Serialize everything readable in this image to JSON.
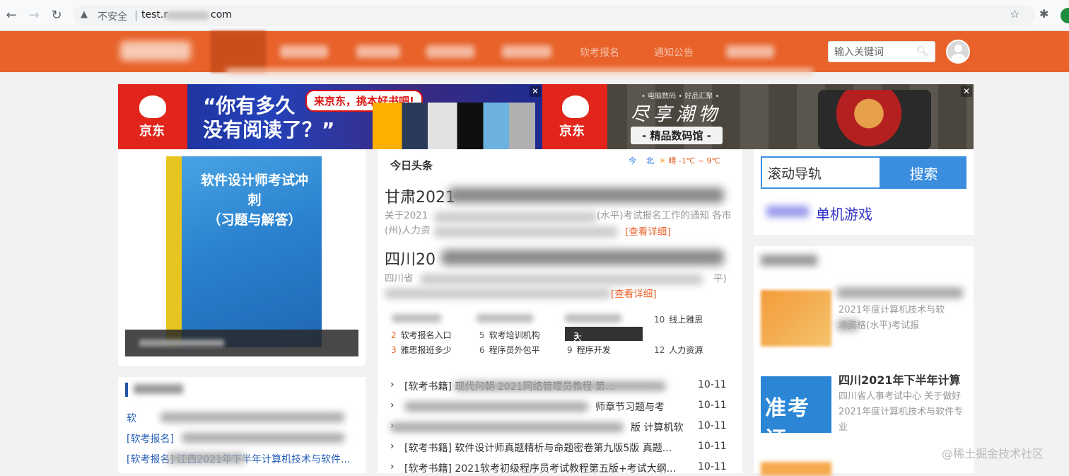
{
  "browser": {
    "insecure_label": "不安全",
    "url_prefix": "test.r",
    "url_suffix": "com"
  },
  "header": {
    "nav": [
      "软考报名",
      "通知公告"
    ],
    "search_placeholder": "输入关键词"
  },
  "ads": {
    "left_brand": "京东",
    "left_quote": "“你有多久\n没有阅读了？”",
    "left_bubble": "来京东，挑本好书吧!",
    "right_brand": "京东",
    "right_small": "• 电脑数码 • 好品汇聚 •",
    "right_slogan": "尽享潮物",
    "right_pill": "- 精品数码馆 -",
    "close": "✕"
  },
  "book": {
    "title": "软件设计师考试冲刺\n（习题与解答）"
  },
  "left_news": {
    "items": [
      "软",
      "[软考报名]",
      "[软考报名]  江西2021年下半年计算机技术与软件..."
    ]
  },
  "today": {
    "title": "今日头条",
    "weather_today": "今",
    "weather_city": "北",
    "weather_temp": "晴 -1℃ ~ 9℃",
    "headline1": "甘肃2021",
    "summary1_a": "关于2021",
    "summary1_b": "(水平)考试报名工作的通知 各市",
    "summary1_c": "(州)人力资",
    "more1": "[查看详细]",
    "headline2": "四川20",
    "summary2_a": "四川省",
    "summary2_b": "平)",
    "more2": "[查看详细]"
  },
  "rank": {
    "items": [
      {
        "num": "10",
        "label": "线上雅思"
      },
      {
        "num": "2",
        "label": "软考报名入口"
      },
      {
        "num": "5",
        "label": "软考培训机构"
      },
      {
        "num": "3",
        "label": "大专生出国留"
      },
      {
        "num": "3",
        "label": "雅思报班多少"
      },
      {
        "num": "6",
        "label": "程序员外包平"
      },
      {
        "num": "9",
        "label": "程序开发"
      },
      {
        "num": "12",
        "label": "人力资源"
      }
    ]
  },
  "news_list": [
    {
      "text": "[软考书籍] 现代何朝 2021网络管理员教程 第...",
      "date": "10-11"
    },
    {
      "text": "师章节习题与考",
      "date": "10-11"
    },
    {
      "text": "版 计算机软",
      "date": "10-11"
    },
    {
      "text": "[软考书籍] 软件设计师真题精析与命题密卷第九版5版 真题...",
      "date": "10-11"
    },
    {
      "text": "[软考书籍] 2021软考初级程序员考试教程第五版+考试大纲...",
      "date": "10-11"
    }
  ],
  "sidebar": {
    "input_value": "滚动导轨",
    "search_btn": "搜索",
    "link_text": "单机游戏",
    "card1_text": "2021年度计算机技术与软\n术资格(水平)考试报",
    "card2_title": "四川2021年下半年计算",
    "card2_text": "四川省人事考试中心 关于做好\n2021年度计算机技术与软件专\n业",
    "thumb2_label": "准考证"
  },
  "watermark": "@稀土掘金技术社区"
}
